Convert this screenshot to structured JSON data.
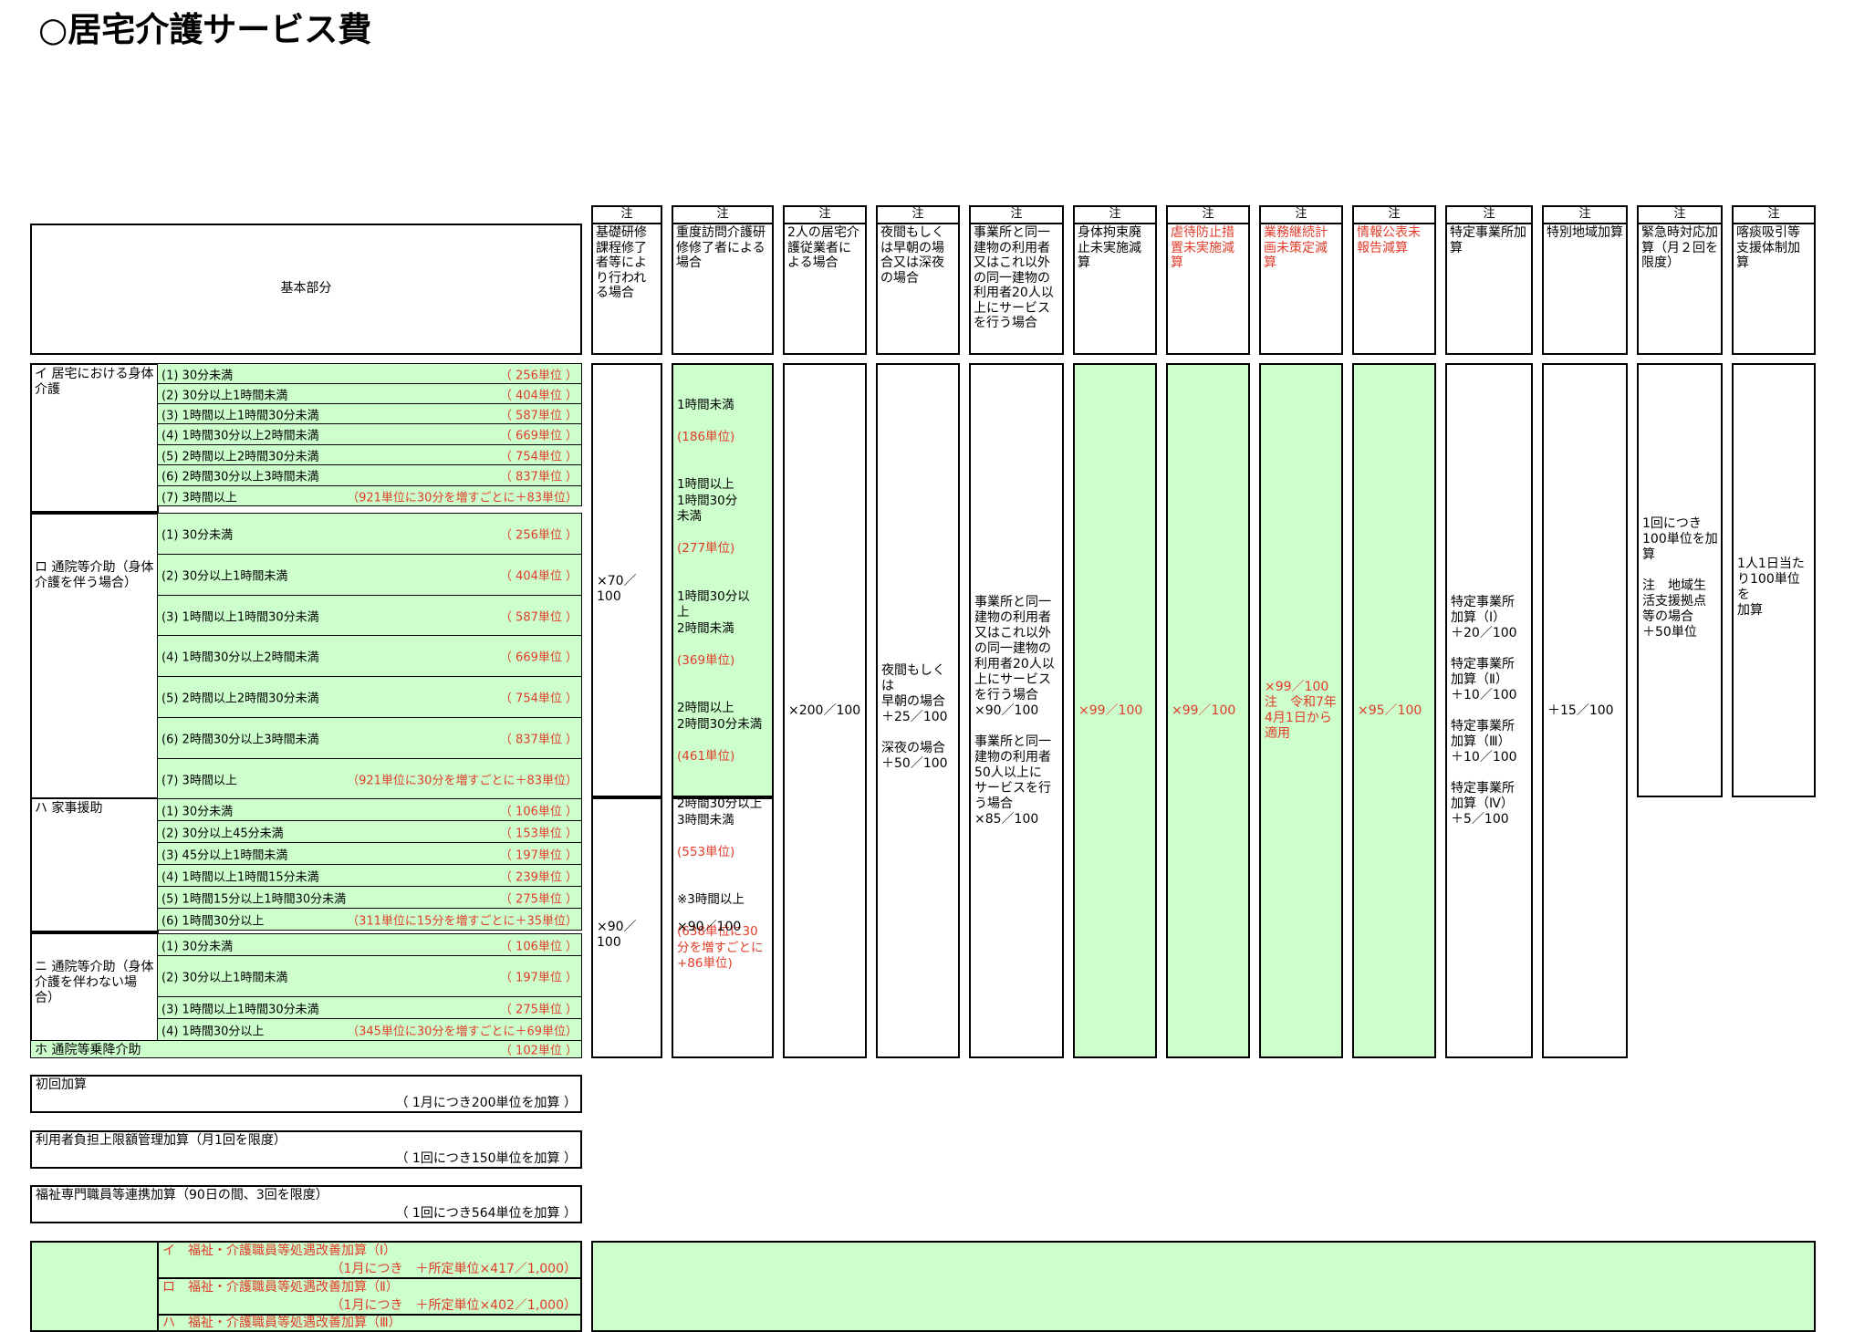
{
  "title": "○居宅介護サービス費",
  "kihon_label": "基本部分",
  "chuu": "注",
  "headers": [
    "基礎研修課程修了者等により行われる場合",
    "重度訪問介護研修修了者による場合",
    "2人の居宅介護従業者による場合",
    "夜間もしくは早朝の場合又は深夜の場合",
    "事業所と同一建物の利用者又はこれ以外の同一建物の利用者20人以上にサービスを行う場合",
    "身体拘束廃止未実施減算",
    "虐待防止措置未実施減算",
    "業務継続計画未策定減算",
    "情報公表未報告減算",
    "特定事業所加算",
    "特別地域加算",
    "緊急時対応加算（月２回を限度）",
    "喀痰吸引等支援体制加算"
  ],
  "categories": {
    "i": "イ 居宅における身体介護",
    "ro": "ロ 通院等介助（身体介護を伴う場合）",
    "ha": "ハ 家事援助",
    "ni": "ニ 通院等介助（身体介護を伴わない場合）",
    "ho": "ホ 通院等乗降介助",
    "ho_units": "（ 102単位 ）"
  },
  "rows_i": [
    {
      "label": "(1)  30分未満",
      "units": "（ 256単位 ）"
    },
    {
      "label": "(2)  30分以上1時間未満",
      "units": "（ 404単位 ）"
    },
    {
      "label": "(3)  1時間以上1時間30分未満",
      "units": "（ 587単位 ）"
    },
    {
      "label": "(4)  1時間30分以上2時間未満",
      "units": "（ 669単位 ）"
    },
    {
      "label": "(5)  2時間以上2時間30分未満",
      "units": "（ 754単位 ）"
    },
    {
      "label": "(6)  2時間30分以上3時間未満",
      "units": "（ 837単位 ）"
    },
    {
      "label": "(7)  3時間以上",
      "units": "（921単位に30分を増すごとに＋83単位）"
    }
  ],
  "rows_ro": [
    {
      "label": "(1)  30分未満",
      "units": "（ 256単位 ）"
    },
    {
      "label": "(2)  30分以上1時間未満",
      "units": "（ 404単位 ）"
    },
    {
      "label": "(3)  1時間以上1時間30分未満",
      "units": "（ 587単位 ）"
    },
    {
      "label": "(4)  1時間30分以上2時間未満",
      "units": "（ 669単位 ）"
    },
    {
      "label": "(5)  2時間以上2時間30分未満",
      "units": "（ 754単位 ）"
    },
    {
      "label": "(6)  2時間30分以上3時間未満",
      "units": "（ 837単位 ）"
    },
    {
      "label": "(7)  3時間以上",
      "units": "（921単位に30分を増すごとに＋83単位）"
    }
  ],
  "rows_ha": [
    {
      "label": "(1)  30分未満",
      "units": "（ 106単位 ）"
    },
    {
      "label": "(2)  30分以上45分未満",
      "units": "（ 153単位 ）"
    },
    {
      "label": "(3)  45分以上1時間未満",
      "units": "（ 197単位 ）"
    },
    {
      "label": "(4)  1時間以上1時間15分未満",
      "units": "（ 239単位 ）"
    },
    {
      "label": "(5)  1時間15分以上1時間30分未満",
      "units": "（ 275単位 ）"
    },
    {
      "label": "(6)  1時間30分以上",
      "units": "（311単位に15分を増すごとに＋35単位）"
    }
  ],
  "rows_ni": [
    {
      "label": "(1)  30分未満",
      "units": "（ 106単位 ）"
    },
    {
      "label": "(2)  30分以上1時間未満",
      "units": "（ 197単位 ）"
    },
    {
      "label": "(3)  1時間以上1時間30分未満",
      "units": "（ 275単位 ）"
    },
    {
      "label": "(4)  1時間30分以上",
      "units": "（345単位に30分を増すごとに＋69単位）"
    }
  ],
  "cells": {
    "kiso_upper": "×70／100",
    "kiso_lower": "×90／100",
    "judo_a": "1時間未満",
    "judo_a_u": "(186単位)",
    "judo_b": "1時間以上\n1時間30分\n未満",
    "judo_b_u": "(277単位)",
    "judo_c": "1時間30分以\n上\n2時間未満",
    "judo_c_u": "(369単位)",
    "judo_d": "2時間以上\n2時間30分未満",
    "judo_d_u": "(461単位)",
    "judo_e": "2時間30分以上\n3時間未満",
    "judo_e_u": "(553単位)",
    "judo_f": "※3時間以上",
    "judo_f_u": "(638単位に30\n分を増すごとに\n+86単位)",
    "judo_lower": "×90／100",
    "futari": "×200／100",
    "yakan": "夜間もしくは\n早朝の場合\n＋25／100\n\n深夜の場合\n＋50／100",
    "doitsu": "事業所と同一\n建物の利用者\n又はこれ以外\nの同一建物の\n利用者20人以\n上にサービス\nを行う場合\n×90／100\n\n事業所と同一\n建物の利用者\n50人以上に\nサービスを行\nう場合\n×85／100",
    "shintai": "×99／100",
    "gyakutai": "×99／100",
    "gyomu": "×99／100\n注　令和7年\n4月1日から\n適用",
    "johou": "×95／100",
    "tokutei": "特定事業所\n加算（Ⅰ）\n＋20／100\n\n特定事業所\n加算（Ⅱ）\n＋10／100\n\n特定事業所\n加算（Ⅲ）\n＋10／100\n\n特定事業所\n加算（Ⅳ）\n＋5／100",
    "tokubetsu": "＋15／100",
    "kinkyu": "1回につき\n100単位を加\n算\n\n注　地域生\n活支援拠点\n等の場合\n＋50単位",
    "kakutan": "1人1日当た\nり100単位を\n加算"
  },
  "kasan": [
    {
      "name": "初回加算",
      "value": "（ 1月につき200単位を加算 ）"
    },
    {
      "name": "利用者負担上限額管理加算（月1回を限度）",
      "value": "（ 1回につき150単位を加算 ）"
    },
    {
      "name": "福祉専門職員等連携加算（90日の間、3回を限度）",
      "value": "（ 1回につき564単位を加算 ）"
    }
  ],
  "shogu": [
    {
      "name": "イ　福祉・介護職員等処遇改善加算（Ⅰ）",
      "value": "（1月につき　＋所定単位×417／1,000）"
    },
    {
      "name": "ロ　福祉・介護職員等処遇改善加算（Ⅱ）",
      "value": "（1月につき　＋所定単位×402／1,000）"
    },
    {
      "name": "ハ　福祉・介護職員等処遇改善加算（Ⅲ）",
      "value": ""
    }
  ]
}
